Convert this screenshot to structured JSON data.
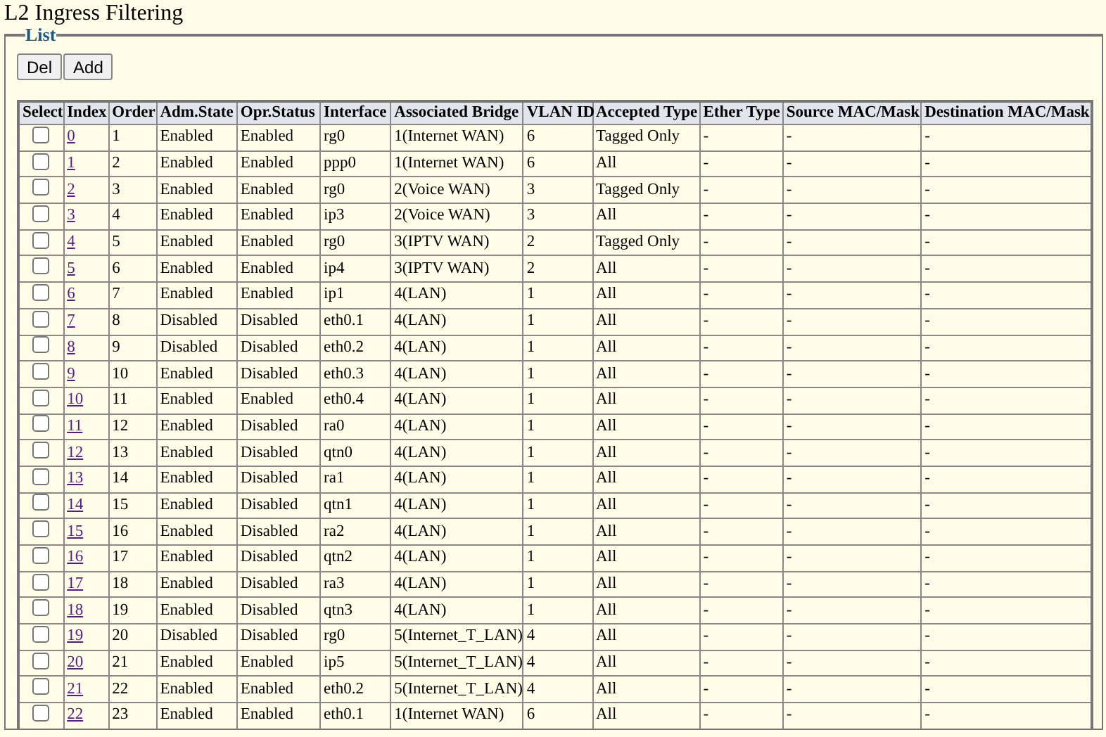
{
  "page": {
    "title": "L2 Ingress Filtering"
  },
  "list": {
    "legend": "List",
    "buttons": [
      "Del",
      "Add"
    ],
    "columns": [
      "Select",
      "Index",
      "Order",
      "Adm.State",
      "Opr.Status",
      "Interface",
      "Associated Bridge",
      "VLAN ID",
      "Accepted Type",
      "Ether Type",
      "Source MAC/Mask",
      "Destination MAC/Mask"
    ],
    "rows": [
      {
        "checked": false,
        "index": "0",
        "order": "1",
        "adm_state": "Enabled",
        "opr_status": "Enabled",
        "interface": "rg0",
        "bridge": "1(Internet WAN)",
        "vlan_id": "6",
        "accepted_type": "Tagged Only",
        "ether_type": "-",
        "source_mac": "-",
        "destination_mac": "-"
      },
      {
        "checked": false,
        "index": "1",
        "order": "2",
        "adm_state": "Enabled",
        "opr_status": "Enabled",
        "interface": "ppp0",
        "bridge": "1(Internet WAN)",
        "vlan_id": "6",
        "accepted_type": "All",
        "ether_type": "-",
        "source_mac": "-",
        "destination_mac": "-"
      },
      {
        "checked": false,
        "index": "2",
        "order": "3",
        "adm_state": "Enabled",
        "opr_status": "Enabled",
        "interface": "rg0",
        "bridge": "2(Voice WAN)",
        "vlan_id": "3",
        "accepted_type": "Tagged Only",
        "ether_type": "-",
        "source_mac": "-",
        "destination_mac": "-"
      },
      {
        "checked": false,
        "index": "3",
        "order": "4",
        "adm_state": "Enabled",
        "opr_status": "Enabled",
        "interface": "ip3",
        "bridge": "2(Voice WAN)",
        "vlan_id": "3",
        "accepted_type": "All",
        "ether_type": "-",
        "source_mac": "-",
        "destination_mac": "-"
      },
      {
        "checked": false,
        "index": "4",
        "order": "5",
        "adm_state": "Enabled",
        "opr_status": "Enabled",
        "interface": "rg0",
        "bridge": "3(IPTV WAN)",
        "vlan_id": "2",
        "accepted_type": "Tagged Only",
        "ether_type": "-",
        "source_mac": "-",
        "destination_mac": "-"
      },
      {
        "checked": false,
        "index": "5",
        "order": "6",
        "adm_state": "Enabled",
        "opr_status": "Enabled",
        "interface": "ip4",
        "bridge": "3(IPTV WAN)",
        "vlan_id": "2",
        "accepted_type": "All",
        "ether_type": "-",
        "source_mac": "-",
        "destination_mac": "-"
      },
      {
        "checked": false,
        "index": "6",
        "order": "7",
        "adm_state": "Enabled",
        "opr_status": "Enabled",
        "interface": "ip1",
        "bridge": "4(LAN)",
        "vlan_id": "1",
        "accepted_type": "All",
        "ether_type": "-",
        "source_mac": "-",
        "destination_mac": "-"
      },
      {
        "checked": false,
        "index": "7",
        "order": "8",
        "adm_state": "Disabled",
        "opr_status": "Disabled",
        "interface": "eth0.1",
        "bridge": "4(LAN)",
        "vlan_id": "1",
        "accepted_type": "All",
        "ether_type": "-",
        "source_mac": "-",
        "destination_mac": "-"
      },
      {
        "checked": false,
        "index": "8",
        "order": "9",
        "adm_state": "Disabled",
        "opr_status": "Disabled",
        "interface": "eth0.2",
        "bridge": "4(LAN)",
        "vlan_id": "1",
        "accepted_type": "All",
        "ether_type": "-",
        "source_mac": "-",
        "destination_mac": "-"
      },
      {
        "checked": false,
        "index": "9",
        "order": "10",
        "adm_state": "Enabled",
        "opr_status": "Disabled",
        "interface": "eth0.3",
        "bridge": "4(LAN)",
        "vlan_id": "1",
        "accepted_type": "All",
        "ether_type": "-",
        "source_mac": "-",
        "destination_mac": "-"
      },
      {
        "checked": false,
        "index": "10",
        "order": "11",
        "adm_state": "Enabled",
        "opr_status": "Enabled",
        "interface": "eth0.4",
        "bridge": "4(LAN)",
        "vlan_id": "1",
        "accepted_type": "All",
        "ether_type": "-",
        "source_mac": "-",
        "destination_mac": "-"
      },
      {
        "checked": false,
        "index": "11",
        "order": "12",
        "adm_state": "Enabled",
        "opr_status": "Disabled",
        "interface": "ra0",
        "bridge": "4(LAN)",
        "vlan_id": "1",
        "accepted_type": "All",
        "ether_type": "-",
        "source_mac": "-",
        "destination_mac": "-"
      },
      {
        "checked": false,
        "index": "12",
        "order": "13",
        "adm_state": "Enabled",
        "opr_status": "Disabled",
        "interface": "qtn0",
        "bridge": "4(LAN)",
        "vlan_id": "1",
        "accepted_type": "All",
        "ether_type": "-",
        "source_mac": "-",
        "destination_mac": "-"
      },
      {
        "checked": false,
        "index": "13",
        "order": "14",
        "adm_state": "Enabled",
        "opr_status": "Disabled",
        "interface": "ra1",
        "bridge": "4(LAN)",
        "vlan_id": "1",
        "accepted_type": "All",
        "ether_type": "-",
        "source_mac": "-",
        "destination_mac": "-"
      },
      {
        "checked": false,
        "index": "14",
        "order": "15",
        "adm_state": "Enabled",
        "opr_status": "Disabled",
        "interface": "qtn1",
        "bridge": "4(LAN)",
        "vlan_id": "1",
        "accepted_type": "All",
        "ether_type": "-",
        "source_mac": "-",
        "destination_mac": "-"
      },
      {
        "checked": false,
        "index": "15",
        "order": "16",
        "adm_state": "Enabled",
        "opr_status": "Disabled",
        "interface": "ra2",
        "bridge": "4(LAN)",
        "vlan_id": "1",
        "accepted_type": "All",
        "ether_type": "-",
        "source_mac": "-",
        "destination_mac": "-"
      },
      {
        "checked": false,
        "index": "16",
        "order": "17",
        "adm_state": "Enabled",
        "opr_status": "Disabled",
        "interface": "qtn2",
        "bridge": "4(LAN)",
        "vlan_id": "1",
        "accepted_type": "All",
        "ether_type": "-",
        "source_mac": "-",
        "destination_mac": "-"
      },
      {
        "checked": false,
        "index": "17",
        "order": "18",
        "adm_state": "Enabled",
        "opr_status": "Disabled",
        "interface": "ra3",
        "bridge": "4(LAN)",
        "vlan_id": "1",
        "accepted_type": "All",
        "ether_type": "-",
        "source_mac": "-",
        "destination_mac": "-"
      },
      {
        "checked": false,
        "index": "18",
        "order": "19",
        "adm_state": "Enabled",
        "opr_status": "Disabled",
        "interface": "qtn3",
        "bridge": "4(LAN)",
        "vlan_id": "1",
        "accepted_type": "All",
        "ether_type": "-",
        "source_mac": "-",
        "destination_mac": "-"
      },
      {
        "checked": false,
        "index": "19",
        "order": "20",
        "adm_state": "Disabled",
        "opr_status": "Disabled",
        "interface": "rg0",
        "bridge": "5(Internet_T_LAN)",
        "vlan_id": "4",
        "accepted_type": "All",
        "ether_type": "-",
        "source_mac": "-",
        "destination_mac": "-"
      },
      {
        "checked": false,
        "index": "20",
        "order": "21",
        "adm_state": "Enabled",
        "opr_status": "Enabled",
        "interface": "ip5",
        "bridge": "5(Internet_T_LAN)",
        "vlan_id": "4",
        "accepted_type": "All",
        "ether_type": "-",
        "source_mac": "-",
        "destination_mac": "-"
      },
      {
        "checked": false,
        "index": "21",
        "order": "22",
        "adm_state": "Enabled",
        "opr_status": "Enabled",
        "interface": "eth0.2",
        "bridge": "5(Internet_T_LAN)",
        "vlan_id": "4",
        "accepted_type": "All",
        "ether_type": "-",
        "source_mac": "-",
        "destination_mac": "-"
      },
      {
        "checked": false,
        "index": "22",
        "order": "23",
        "adm_state": "Enabled",
        "opr_status": "Enabled",
        "interface": "eth0.1",
        "bridge": "1(Internet WAN)",
        "vlan_id": "6",
        "accepted_type": "All",
        "ether_type": "-",
        "source_mac": "-",
        "destination_mac": "-"
      }
    ]
  }
}
